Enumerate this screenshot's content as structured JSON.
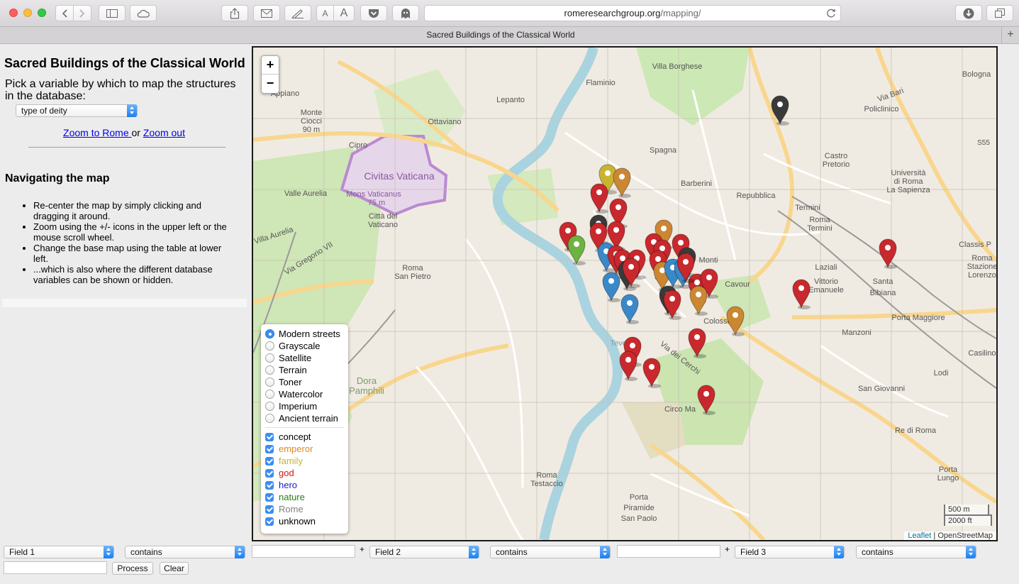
{
  "browser": {
    "url_domain": "romeresearchgroup.org",
    "url_path": "/mapping/",
    "tab_title": "Sacred Buildings of the Classical World",
    "text_size_small": "A",
    "text_size_large": "A"
  },
  "sidebar": {
    "title": "Sacred Buildings of the Classical World",
    "pick_text": "Pick a variable by which to map the structures in the database:",
    "variable_select": "type of deity",
    "zoom_rome": "Zoom to Rome ",
    "zoom_or": "or ",
    "zoom_out": "Zoom out",
    "nav_title": "Navigating the map",
    "nav_items": [
      "Re-center the map by simply clicking and dragging it around.",
      "Zoom using the +/- icons in the upper left or the mouse scroll wheel.",
      "Change the base map using the table at lower left.",
      "...which is also where the different database variables can be shown or hidden."
    ]
  },
  "map": {
    "zoom_in": "+",
    "zoom_out": "−",
    "base_layers": [
      {
        "label": "Modern streets",
        "selected": true
      },
      {
        "label": "Grayscale",
        "selected": false
      },
      {
        "label": "Satellite",
        "selected": false
      },
      {
        "label": "Terrain",
        "selected": false
      },
      {
        "label": "Toner",
        "selected": false
      },
      {
        "label": "Watercolor",
        "selected": false
      },
      {
        "label": "Imperium",
        "selected": false
      },
      {
        "label": "Ancient terrain",
        "selected": false
      }
    ],
    "overlays": [
      {
        "label": "concept",
        "color": "#000000",
        "checked": true
      },
      {
        "label": "emperor",
        "color": "#e08a1e",
        "checked": true
      },
      {
        "label": "family",
        "color": "#c9b232",
        "checked": true
      },
      {
        "label": "god",
        "color": "#d11919",
        "checked": true
      },
      {
        "label": "hero",
        "color": "#1c1cc8",
        "checked": true
      },
      {
        "label": "nature",
        "color": "#2b7a16",
        "checked": true
      },
      {
        "label": "Rome",
        "color": "#808080",
        "checked": true
      },
      {
        "label": "unknown",
        "color": "#000000",
        "checked": true
      }
    ],
    "scale_metric": "500 m",
    "scale_imperial": "2000 ft",
    "attrib_leaflet": "Leaflet",
    "attrib_sep": " | ",
    "attrib_osm": "OpenStreetMap",
    "place_labels": [
      {
        "text": "Villa Borghese"
      },
      {
        "text": "Flaminio"
      },
      {
        "text": "Bologna"
      },
      {
        "text": "Appiano"
      },
      {
        "text": "Lepanto"
      },
      {
        "text": "Ottaviano"
      },
      {
        "text": "Monte"
      },
      {
        "text": "Ciocci"
      },
      {
        "text": "90 m"
      },
      {
        "text": "Cipro"
      },
      {
        "text": "Spagna"
      },
      {
        "text": "Policlinico"
      },
      {
        "text": "Castro"
      },
      {
        "text": "Pretorio"
      },
      {
        "text": "Civitas Vaticana"
      },
      {
        "text": "Mons Vaticanus"
      },
      {
        "text": "75 m"
      },
      {
        "text": "Valle Aurelia"
      },
      {
        "text": "Barberini"
      },
      {
        "text": "Repubblica"
      },
      {
        "text": "Città del"
      },
      {
        "text": "Vaticano"
      },
      {
        "text": "Termini"
      },
      {
        "text": "Roma"
      },
      {
        "text": "Termini"
      },
      {
        "text": "Monti"
      },
      {
        "text": "Cavour"
      },
      {
        "text": "Vittorio"
      },
      {
        "text": "Emanuele"
      },
      {
        "text": "Santa"
      },
      {
        "text": "Bibiana"
      },
      {
        "text": "Roma"
      },
      {
        "text": "San Pietro"
      },
      {
        "text": "Colosseo"
      },
      {
        "text": "Manzoni"
      },
      {
        "text": "Porta Maggiore"
      },
      {
        "text": "Via dei Cerchi"
      },
      {
        "text": "Dora"
      },
      {
        "text": "Circo Ma"
      },
      {
        "text": "San Giovanni"
      },
      {
        "text": "Lodi"
      },
      {
        "text": "Re di Roma"
      },
      {
        "text": "Porta"
      },
      {
        "text": "Roma"
      },
      {
        "text": "Testaccio"
      },
      {
        "text": "San Paolo"
      },
      {
        "text": "Piramide"
      },
      {
        "text": "Villa Aurelia"
      },
      {
        "text": "Via Gregorio VII"
      },
      {
        "text": "Laziali"
      },
      {
        "text": "Stazione"
      },
      {
        "text": "Lorenzo"
      },
      {
        "text": "Casilino"
      },
      {
        "text": "Roma"
      },
      {
        "text": "Tevere"
      },
      {
        "text": "Università"
      },
      {
        "text": "di Roma"
      },
      {
        "text": "La Sapienza"
      },
      {
        "text": "Classis P"
      },
      {
        "text": "Porta"
      },
      {
        "text": "Lungo"
      },
      {
        "text": "S55"
      },
      {
        "text": "Via Bari"
      },
      {
        "text": "Pamphili"
      }
    ],
    "markers": [
      {
        "type": "concept"
      },
      {
        "type": "family"
      },
      {
        "type": "emperor"
      },
      {
        "type": "god"
      },
      {
        "type": "god"
      },
      {
        "type": "god"
      },
      {
        "type": "concept"
      },
      {
        "type": "god"
      },
      {
        "type": "god"
      },
      {
        "type": "nature"
      },
      {
        "type": "hero"
      },
      {
        "type": "god"
      },
      {
        "type": "god"
      },
      {
        "type": "concept"
      },
      {
        "type": "god"
      },
      {
        "type": "god"
      },
      {
        "type": "hero"
      },
      {
        "type": "hero"
      },
      {
        "type": "emperor"
      },
      {
        "type": "god"
      },
      {
        "type": "god"
      },
      {
        "type": "god"
      },
      {
        "type": "concept"
      },
      {
        "type": "god"
      },
      {
        "type": "emperor"
      },
      {
        "type": "hero"
      },
      {
        "type": "hero"
      },
      {
        "type": "concept"
      },
      {
        "type": "god"
      },
      {
        "type": "god"
      },
      {
        "type": "god"
      },
      {
        "type": "emperor"
      },
      {
        "type": "emperor"
      },
      {
        "type": "god"
      },
      {
        "type": "god"
      },
      {
        "type": "god"
      },
      {
        "type": "god"
      },
      {
        "type": "god"
      },
      {
        "type": "god"
      },
      {
        "type": "god"
      },
      {
        "type": "god"
      }
    ]
  },
  "query": {
    "field1": "Field 1",
    "field2": "Field 2",
    "field3": "Field 3",
    "op1": "contains",
    "op2": "contains",
    "op3": "contains",
    "plus": "+",
    "process": "Process",
    "clear": "Clear"
  }
}
